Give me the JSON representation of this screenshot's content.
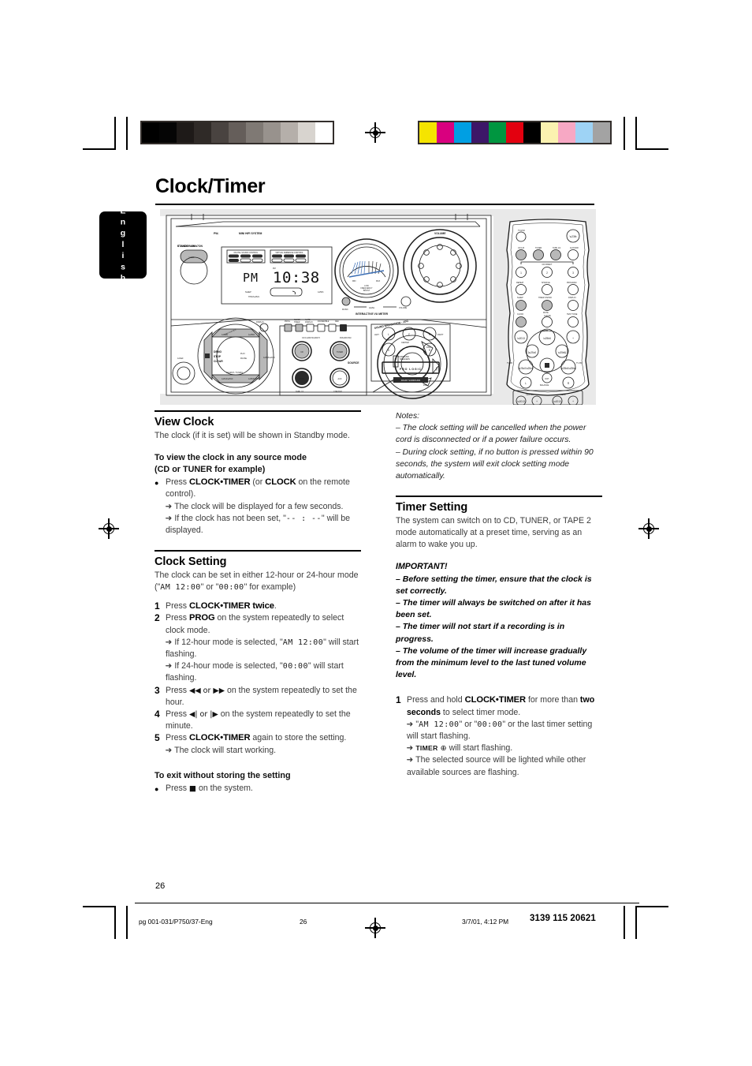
{
  "document": {
    "language_tab": "English",
    "page_title": "Clock/Timer",
    "page_number": "26"
  },
  "color_bars": {
    "grayscale": [
      "#000000",
      "#050505",
      "#1e1a18",
      "#2f2a27",
      "#494340",
      "#655e5a",
      "#7f7974",
      "#98928d",
      "#b5afaa",
      "#d8d4cf",
      "#ffffff"
    ],
    "color": [
      "#f5e400",
      "#d9007f",
      "#009fe3",
      "#3d1768",
      "#009640",
      "#e3000f",
      "#000000",
      "#fbf2b0",
      "#f7a8c4",
      "#9ed3f5",
      "#a3a3a3"
    ]
  },
  "illustration": {
    "name": "mini-hifi-system-front-panel-and-remote",
    "display_text": "PM 10:38",
    "labels": {
      "brand": "PW-",
      "system": "MINI HIFI SYSTEM",
      "standby": "STANDBY·ON",
      "volume": "VOLUME",
      "vu_meter": "INTERACTIVE VU METER",
      "sound_nav": "SOUND NAVIGATION - JOG",
      "digital_sound_control": "DIGITAL SOUND CONTROL",
      "virtual_ambience_control": "VIRTUAL AMBIENCE CONTROL",
      "pro_logic": "PRO LOGIC",
      "dolby": "DOLBY SURROUND",
      "sleep": "SLEEP",
      "timer": "TIMER",
      "source": "SOURCE",
      "display": "DISPLAY",
      "prog": "PROG",
      "clock_timer": "CLOCK·TIMER",
      "cd": "CD",
      "tuner": "TUNER",
      "tape": "TAPE",
      "aux": "AUX",
      "cd_tray": "CD 1·2·3",
      "fm_am": "FM·AM",
      "tape_12": "TAPE 1/2",
      "cdr_dvd": "CDR/DVD",
      "music": "MUSIC",
      "level": "LEVEL",
      "left": "LEFT",
      "right": "RIGHT",
      "center": "CENTER",
      "surround_speakers": "SURROUND SPEAKERS"
    },
    "remote_labels": {
      "tvvcr": "TV/VCR",
      "cd_row": [
        "CD 123",
        "TUNER",
        "TAPE 1/2",
        "AUX/CDR"
      ],
      "cd_direct": "CD DIRECT",
      "numbers": [
        "1",
        "2",
        "3"
      ],
      "fn_row": [
        "REPEAT",
        "SHUFFLE",
        "PROGRAM"
      ],
      "fn_row2": [
        "SLEEP",
        "TIMER ON/OFF",
        "DISPLAY"
      ],
      "fn_row3": [
        "CLOCK",
        "MUTE",
        "TEST TONE"
      ],
      "volume": "VOLUME",
      "tv_vol": "TV VOL",
      "balance": "BALANCE",
      "center": "CENTER",
      "rear": "REAR"
    }
  },
  "view_clock": {
    "heading": "View Clock",
    "intro": "The clock (if it is set) will be shown in Standby mode.",
    "sub_heading_line1": "To view the clock in any source mode",
    "sub_heading_line2": "(CD or TUNER for example)",
    "bullet_pre": "Press ",
    "bullet_key1": "CLOCK•TIMER",
    "bullet_mid": " (or ",
    "bullet_key2": "CLOCK",
    "bullet_post": " on the remote control).",
    "arrow1": "The clock will be displayed for a few seconds.",
    "arrow2_pre": "If the clock has not been set, \"",
    "arrow2_lcd": "-- : --",
    "arrow2_post": "\" will be displayed."
  },
  "clock_setting": {
    "heading": "Clock Setting",
    "intro_pre": "The clock can be set in either 12-hour or 24-hour mode (\"",
    "intro_lcd1": "AM  12:00",
    "intro_mid": "\" or \"",
    "intro_lcd2": "00:00",
    "intro_post": "\" for example)",
    "steps": [
      {
        "num": "1",
        "pre": "Press ",
        "key": "CLOCK•TIMER twice",
        "post": ".",
        "arrows": []
      },
      {
        "num": "2",
        "pre": "Press ",
        "key": "PROG",
        "post": " on the system repeatedly to select clock mode.",
        "arrows": [
          {
            "pre": "If 12-hour mode is selected, \"",
            "lcd": "AM  12:00",
            "post": "\" will start flashing."
          },
          {
            "pre": "If 24-hour mode is selected, \"",
            "lcd": "00:00",
            "post": "\" will start flashing."
          }
        ]
      },
      {
        "num": "3",
        "pre": "Press ",
        "glyph": "◀◀ or ▶▶",
        "post": " on the system repeatedly to set the hour.",
        "arrows": []
      },
      {
        "num": "4",
        "pre": "Press ",
        "glyph": "◀| or |▶",
        "post": " on the system repeatedly to set the minute.",
        "arrows": []
      },
      {
        "num": "5",
        "pre": "Press ",
        "key": "CLOCK•TIMER",
        "post": " again to store the setting.",
        "arrows": [
          {
            "pre": "The clock will start working.",
            "lcd": "",
            "post": ""
          }
        ]
      }
    ],
    "exit_heading": "To exit without storing the setting",
    "exit_pre": "Press ",
    "exit_glyph": "■",
    "exit_post": " on the system."
  },
  "notes": {
    "label": "Notes:",
    "items": [
      "–  The clock setting will be cancelled when the power cord is disconnected or if a power failure occurs.",
      "–  During clock setting, if no button is pressed within 90 seconds, the system will exit clock setting mode automatically."
    ]
  },
  "timer_setting": {
    "heading": "Timer Setting",
    "intro": "The system can switch on to CD, TUNER, or TAPE 2 mode automatically at a preset time, serving as an alarm to wake you up.",
    "important_label": "IMPORTANT!",
    "important_items": [
      "–  Before setting the timer, ensure that the clock is set correctly.",
      "–  The timer will always be switched on after it has been set.",
      "–  The timer will not start if a recording is in progress.",
      "–  The volume of the timer will increase gradually from the minimum level to the last tuned volume level."
    ],
    "step": {
      "num": "1",
      "pre": "Press and hold ",
      "key": "CLOCK•TIMER",
      "mid": " for more than ",
      "key2": "two seconds",
      "post": " to select timer mode.",
      "arrows": [
        {
          "pre": "\"",
          "lcd": "AM  12:00",
          "mid": "\" or \"",
          "lcd2": "00:00",
          "post": "\" or the last timer setting will start flashing."
        },
        {
          "pre": "",
          "sc": "TIMER",
          "glyph": " ⊕ ",
          "post": "will start flashing."
        },
        {
          "pre": "The selected source will be lighted while other available sources are flashing.",
          "post": ""
        }
      ]
    }
  },
  "footer": {
    "file": "pg 001-031/P750/37-Eng",
    "page": "26",
    "date": "3/7/01, 4:12 PM",
    "code": "3139 115 20621"
  }
}
